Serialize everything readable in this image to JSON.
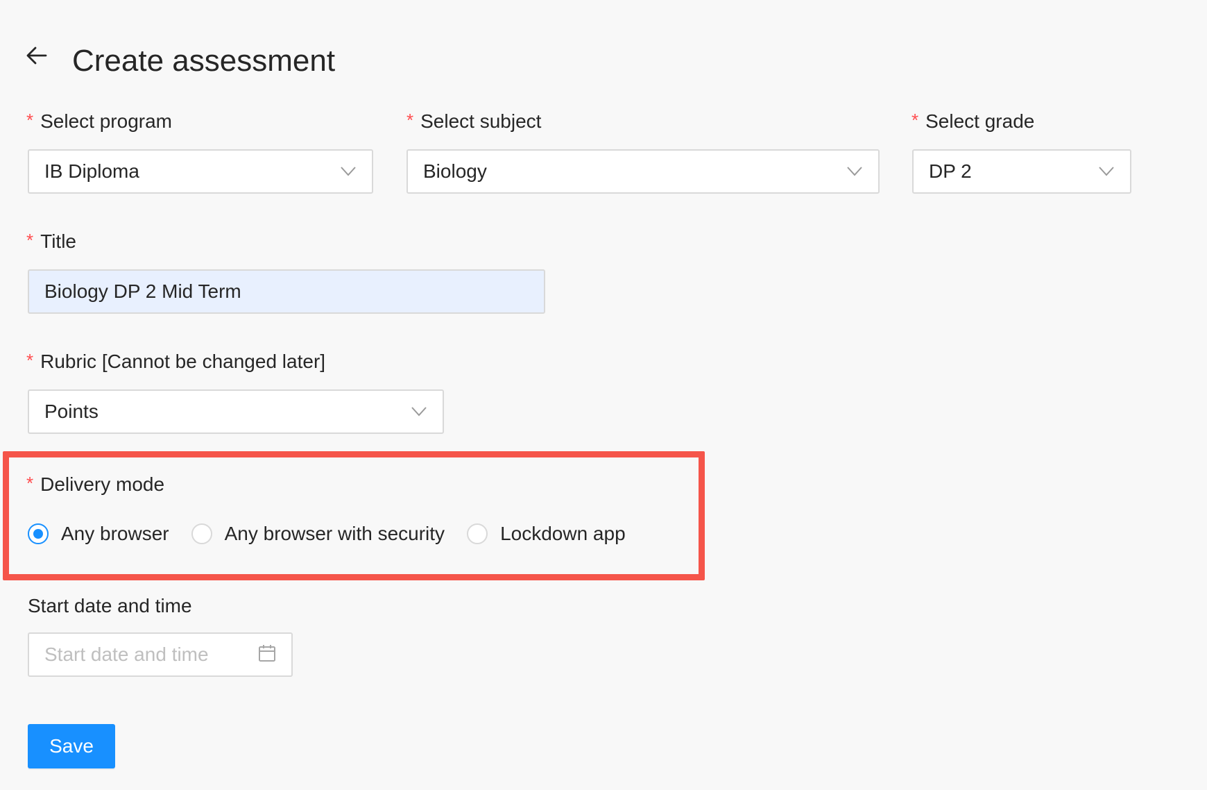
{
  "header": {
    "back_icon": "arrow-left-icon",
    "title": "Create assessment"
  },
  "form": {
    "required_marker": "*",
    "program": {
      "label": "Select program",
      "value": "IB Diploma",
      "icon": "chevron-down-icon"
    },
    "subject": {
      "label": "Select subject",
      "value": "Biology",
      "icon": "chevron-down-icon"
    },
    "grade": {
      "label": "Select grade",
      "value": "DP 2",
      "icon": "chevron-down-icon"
    },
    "title": {
      "label": "Title",
      "value": "Biology DP 2 Mid Term"
    },
    "rubric": {
      "label": "Rubric [Cannot be changed later]",
      "value": "Points",
      "icon": "chevron-down-icon"
    },
    "delivery_mode": {
      "label": "Delivery mode",
      "options": [
        {
          "label": "Any browser",
          "checked": true
        },
        {
          "label": "Any browser with security",
          "checked": false
        },
        {
          "label": "Lockdown app",
          "checked": false
        }
      ]
    },
    "start_date": {
      "label": "Start date and time",
      "placeholder": "Start date and time",
      "icon": "calendar-icon"
    }
  },
  "actions": {
    "save_label": "Save"
  },
  "colors": {
    "primary": "#1890ff",
    "required": "#ff4d4f",
    "highlight": "#f5554a",
    "autofill_bg": "#e8f0fe",
    "page_bg": "#f8f8f8"
  }
}
